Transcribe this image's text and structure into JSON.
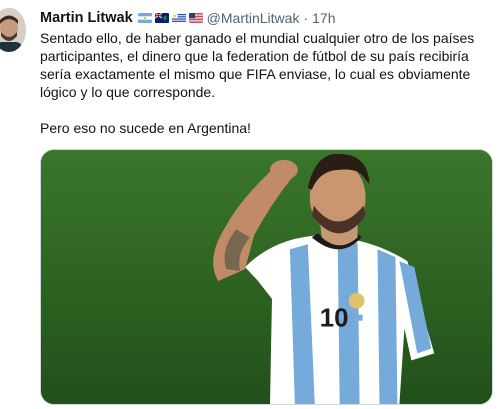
{
  "tweet": {
    "author_name": "Martin Litwak",
    "flags": [
      "argentina-flag",
      "british-virgin-islands-flag",
      "uruguay-flag",
      "usa-flag"
    ],
    "handle": "@MartinLitwak",
    "separator": "·",
    "time": "17h",
    "paragraph_1": "Sentado ello, de haber ganado el mundial cualquier otro de los países participantes, el dinero que la federation de fútbol de su país recibiría sería exactamente el mismo que FIFA enviase, lo cual es obviamente lógico y lo que corresponde.",
    "paragraph_2": "Pero eso no sucede en Argentina!",
    "media": {
      "jersey_number": "10"
    }
  },
  "colors": {
    "text": "#0f1419",
    "secondary": "#536471",
    "pitch_green": "#2e6b24",
    "jersey_sky_blue": "#75aadb"
  }
}
